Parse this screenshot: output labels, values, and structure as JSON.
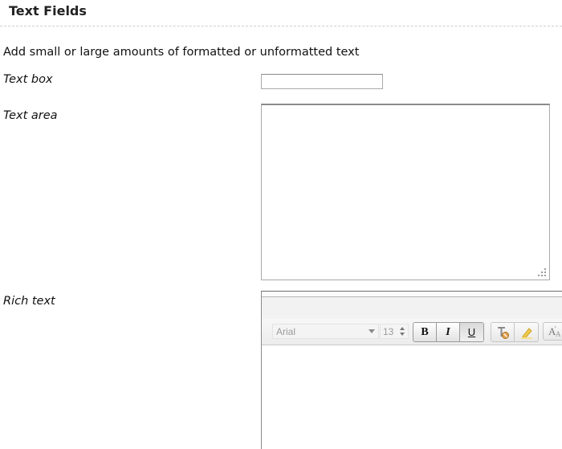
{
  "section": {
    "title": "Text Fields"
  },
  "intro": "Add small or large amounts of formatted or unformatted text",
  "fields": {
    "textbox": {
      "label": "Text box",
      "value": ""
    },
    "textarea": {
      "label": "Text area",
      "value": ""
    },
    "richtext": {
      "label": "Rich text",
      "toolbar": {
        "font": "Arial",
        "size": "13",
        "bold_label": "B",
        "italic_label": "I",
        "underline_label": "U"
      },
      "icons": {
        "clear_format": "clear-formatting-icon",
        "highlighter": "highlighter-icon",
        "text_style": "text-style-icon"
      }
    }
  }
}
